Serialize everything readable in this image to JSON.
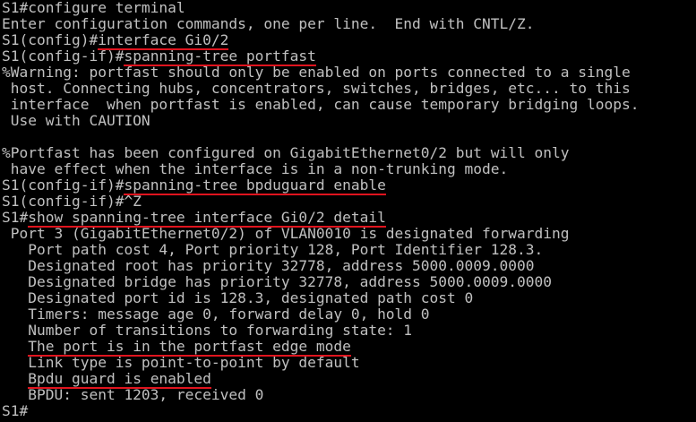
{
  "terminal": {
    "lines": [
      {
        "prefix": "S1#configure terminal"
      },
      {
        "prefix": "Enter configuration commands, one per line.  End with CNTL/Z."
      },
      {
        "prefix": "S1(config)#",
        "cmd": "interface Gi0/2"
      },
      {
        "prefix": "S1(config-if)#",
        "cmd": "spanning-tree portfast"
      },
      {
        "prefix": "%Warning: portfast should only be enabled on ports connected to a single"
      },
      {
        "prefix": " host. Connecting hubs, concentrators, switches, bridges, etc... to this"
      },
      {
        "prefix": " interface  when portfast is enabled, can cause temporary bridging loops."
      },
      {
        "prefix": " Use with CAUTION"
      },
      {
        "prefix": ""
      },
      {
        "prefix": "%Portfast has been configured on GigabitEthernet0/2 but will only"
      },
      {
        "prefix": " have effect when the interface is in a non-trunking mode."
      },
      {
        "prefix": "S1(config-if)#",
        "cmd": "spanning-tree bpduguard enable"
      },
      {
        "prefix": "S1(config-if)#^Z"
      },
      {
        "prefix": "S1#",
        "cmd": "show spanning-tree interface Gi0/2 detail"
      },
      {
        "prefix": " Port 3 (GigabitEthernet0/2) of VLAN0010 is designated forwarding"
      },
      {
        "prefix": "   Port path cost 4, Port priority 128, Port Identifier 128.3."
      },
      {
        "prefix": "   Designated root has priority 32778, address 5000.0009.0000"
      },
      {
        "prefix": "   Designated bridge has priority 32778, address 5000.0009.0000"
      },
      {
        "prefix": "   Designated port id is 128.3, designated path cost 0"
      },
      {
        "prefix": "   Timers: message age 0, forward delay 0, hold 0"
      },
      {
        "prefix": "   Number of transitions to forwarding state: 1"
      },
      {
        "prefix": "   ",
        "cmd": "The port is in the portfast edge mode"
      },
      {
        "prefix": "   Link type is point-to-point by default"
      },
      {
        "prefix": "   ",
        "cmd": "Bpdu guard is enabled"
      },
      {
        "prefix": "   BPDU: sent 1203, received 0"
      },
      {
        "prefix": "S1#"
      }
    ]
  },
  "colors": {
    "background": "#000000",
    "text": "#c0c0c0",
    "highlight_underline": "#e0141e"
  }
}
